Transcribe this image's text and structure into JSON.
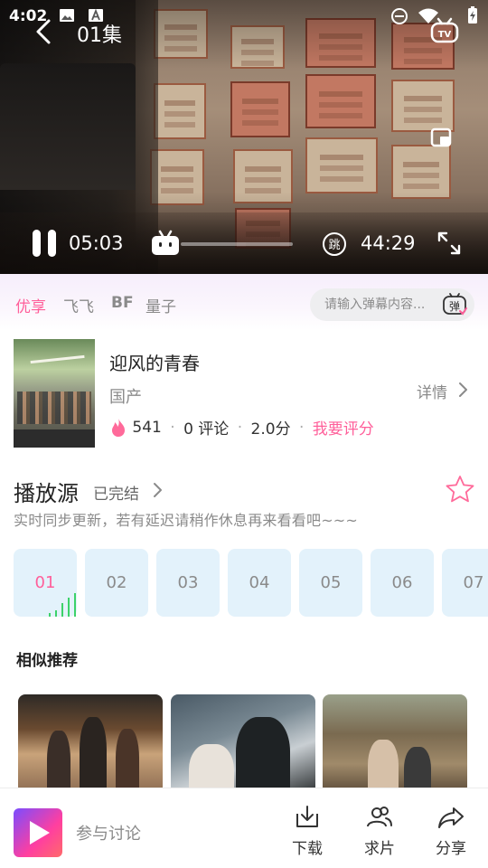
{
  "status_bar": {
    "time": "4:02"
  },
  "player": {
    "episode_title": "01集",
    "current_time": "05:03",
    "total_time": "44:29",
    "progress_fraction": 0.11
  },
  "sources": {
    "tabs": [
      "优享",
      "飞飞",
      "BF",
      "量子"
    ],
    "active_index": 0,
    "danmaku_placeholder": "请输入弹幕内容..."
  },
  "show": {
    "title": "迎风的青春",
    "region": "国产",
    "detail_label": "详情",
    "heat": "541",
    "comments": "0 评论",
    "score": "2.0分",
    "rate_label": "我要评分"
  },
  "play_source": {
    "title": "播放源",
    "status": "已完结",
    "notice": "实时同步更新，若有延迟请稍作休息再来看看吧~~~",
    "episodes": [
      "01",
      "02",
      "03",
      "04",
      "05",
      "06",
      "07"
    ],
    "active_index": 0
  },
  "similar": {
    "title": "相似推荐"
  },
  "bottom_bar": {
    "discuss_label": "参与讨论",
    "download_label": "下载",
    "request_label": "求片",
    "share_label": "分享"
  },
  "colors": {
    "accent": "#ff5f9a",
    "episode_bg": "#e3f2fb"
  }
}
